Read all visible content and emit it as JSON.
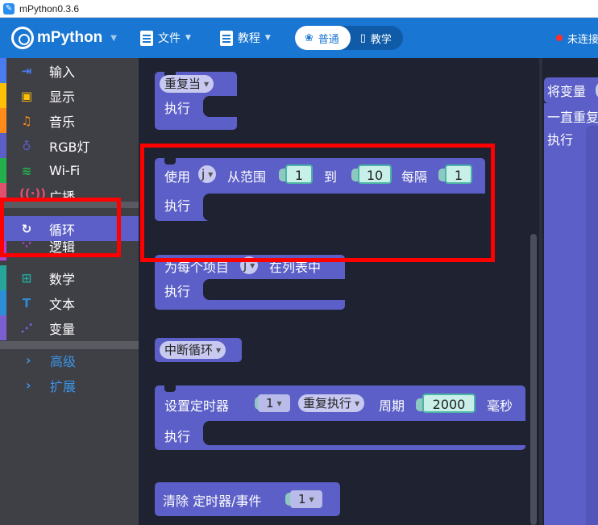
{
  "window": {
    "title": "mPython0.3.6"
  },
  "toolbar": {
    "logo": "mPython",
    "file_label": "文件",
    "tutorial_label": "教程",
    "mode_normal": "普通",
    "mode_teach": "教学",
    "status": "未连接"
  },
  "sidebar": {
    "categories": [
      {
        "label": "输入",
        "icon": "input-icon",
        "color": "#4a7cf0"
      },
      {
        "label": "显示",
        "icon": "display-icon",
        "color": "#ffc107"
      },
      {
        "label": "音乐",
        "icon": "music-icon",
        "color": "#ff8c1a"
      },
      {
        "label": "RGB灯",
        "icon": "rgb-light-icon",
        "color": "#5b5fc7"
      },
      {
        "label": "Wi-Fi",
        "icon": "wifi-icon",
        "color": "#22b14c"
      },
      {
        "label": "广播",
        "icon": "broadcast-icon",
        "color": "#e0516d"
      },
      {
        "label": "循环",
        "icon": "loop-icon",
        "color": "#5b5fc7"
      },
      {
        "label": "逻辑",
        "icon": "logic-icon",
        "color": "#b63fd1"
      },
      {
        "label": "数学",
        "icon": "math-icon",
        "color": "#26a69a"
      },
      {
        "label": "文本",
        "icon": "text-icon",
        "color": "#2c8ed6"
      },
      {
        "label": "变量",
        "icon": "variable-icon",
        "color": "#7b5fd1"
      }
    ],
    "selected": "循环",
    "advanced": "高级",
    "extensions": "扩展"
  },
  "blocks": {
    "repeat_while": {
      "dropdown": "重复当",
      "do": "执行"
    },
    "for_range": {
      "use": "使用",
      "var": "j",
      "from": "从范围",
      "start": "1",
      "to": "到",
      "end": "10",
      "every": "每隔",
      "step": "1",
      "do": "执行"
    },
    "for_each": {
      "text": "为每个项目",
      "var": "j",
      "in_list": "在列表中",
      "do": "执行"
    },
    "break": {
      "dropdown": "中断循环"
    },
    "timer": {
      "label": "设置定时器",
      "id": "1",
      "mode": "重复执行",
      "period": "周期",
      "ms_value": "2000",
      "unit": "毫秒",
      "do": "执行"
    },
    "clear_timer": {
      "label": "清除 定时器/事件",
      "id": "1"
    }
  },
  "workspace": {
    "set_var": "将变量",
    "forever": "一直重复",
    "do": "执行"
  }
}
